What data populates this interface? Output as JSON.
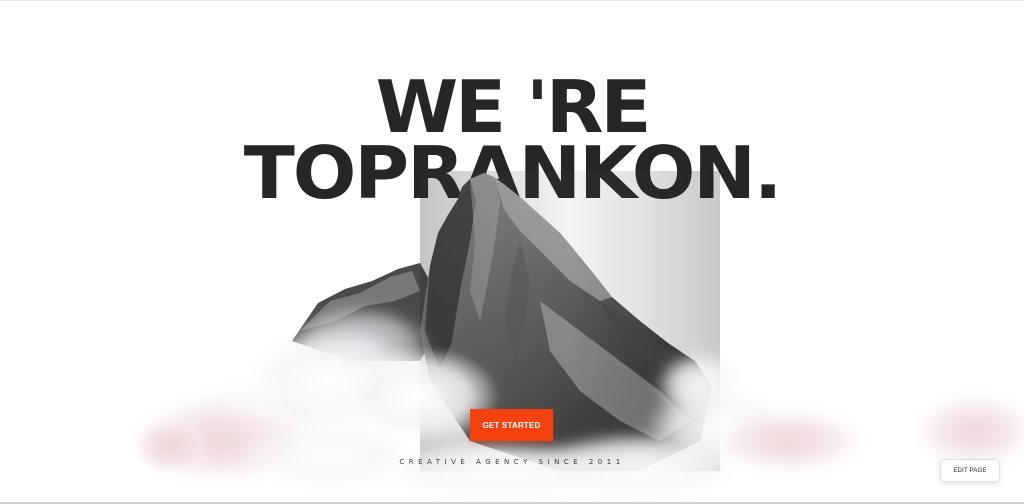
{
  "hero": {
    "headline_line1": "WE 'RE",
    "headline_line2": "TOPRANKON.",
    "cta_label": "GET STARTED",
    "tagline": "CREATIVE AGENCY SINCE 2011"
  },
  "editor": {
    "edit_page_label": "EDIT PAGE"
  },
  "colors": {
    "headline": "#262626",
    "cta_background": "#f3420f",
    "cloud_tint": "#f1dfe2",
    "rock_dark": "#3b3b3b",
    "rock_light": "#a9a9a9"
  }
}
